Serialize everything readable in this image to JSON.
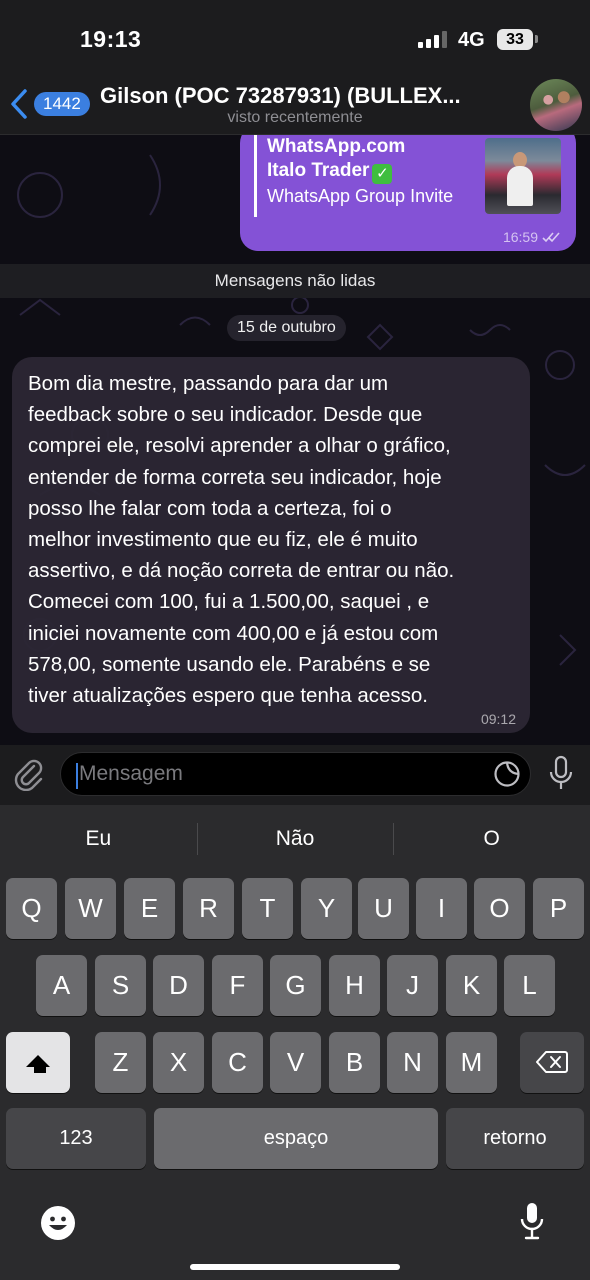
{
  "status_bar": {
    "time": "19:13",
    "network": "4G",
    "battery": "33"
  },
  "header": {
    "unread_count": "1442",
    "contact_name": "Gilson (POC 73287931) (BULLEX...",
    "status": "visto recentemente"
  },
  "chat": {
    "outgoing": {
      "site": "WhatsApp.com",
      "title": "Italo Trader",
      "description": "WhatsApp Group Invite",
      "time": "16:59"
    },
    "unread_divider": "Mensagens não lidas",
    "date_pill": "15 de outubro",
    "incoming": {
      "text": "Bom dia mestre, passando para dar um\nfeedback sobre o seu indicador. Desde que\ncomprei ele, resolvi aprender a olhar o gráfico,\nentender de forma correta seu indicador,  hoje\nposso lhe falar com toda a certeza, foi o\nmelhor investimento que eu fiz, ele é muito\nassertivo, e dá noção correta de entrar ou não.\nComecei com 100, fui a 1.500,00, saquei , e\niniciei novamente com 400,00 e já estou com\n578,00, somente usando ele. Parabéns e se\ntiver atualizações espero que tenha acesso.",
      "time": "09:12"
    }
  },
  "composer": {
    "placeholder": "Mensagem"
  },
  "keyboard": {
    "suggestions": [
      "Eu",
      "Não",
      "O"
    ],
    "row1": [
      "Q",
      "W",
      "E",
      "R",
      "T",
      "Y",
      "U",
      "I",
      "O",
      "P"
    ],
    "row2": [
      "A",
      "S",
      "D",
      "F",
      "G",
      "H",
      "J",
      "K",
      "L"
    ],
    "row3": [
      "Z",
      "X",
      "C",
      "V",
      "B",
      "N",
      "M"
    ],
    "numbers_label": "123",
    "space_label": "espaço",
    "return_label": "retorno"
  }
}
